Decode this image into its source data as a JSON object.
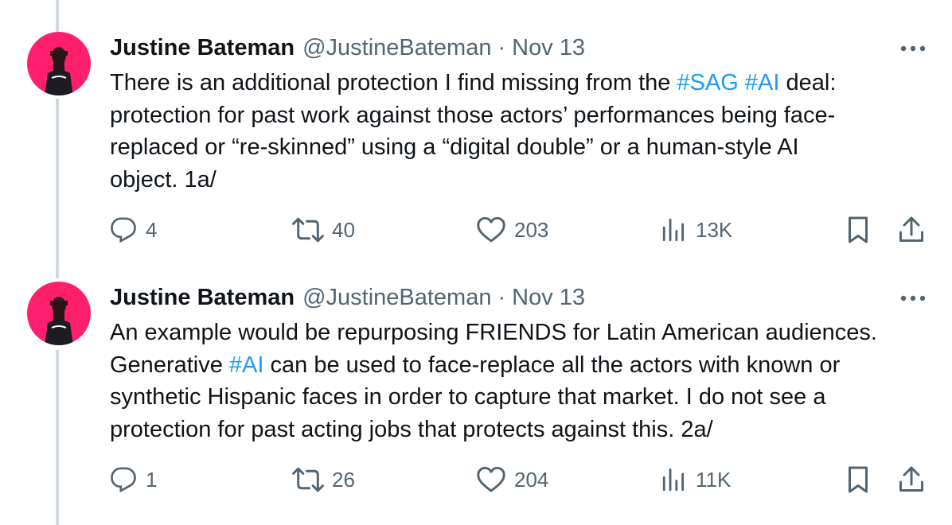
{
  "tweets": [
    {
      "author_name": "Justine Bateman",
      "handle": "@JustineBateman",
      "separator": "·",
      "date": "Nov 13",
      "text_lines": [
        [
          {
            "t": "There is an additional protection I find missing from the "
          },
          {
            "t": "#SAG",
            "h": true
          },
          {
            "t": " "
          },
          {
            "t": "#AI",
            "h": true
          },
          {
            "t": " deal:"
          }
        ],
        [
          {
            "t": "protection for past work against those actors’ performances being face-"
          }
        ],
        [
          {
            "t": "replaced or “re-skinned” using a “digital double” or a human-style AI"
          }
        ],
        [
          {
            "t": "object. 1a/"
          }
        ]
      ],
      "replies": "4",
      "retweets": "40",
      "likes": "203",
      "views": "13K"
    },
    {
      "author_name": "Justine Bateman",
      "handle": "@JustineBateman",
      "separator": "·",
      "date": "Nov 13",
      "text_lines": [
        [
          {
            "t": "An example would be repurposing FRIENDS for Latin American audiences."
          }
        ],
        [
          {
            "t": "Generative "
          },
          {
            "t": "#AI",
            "h": true
          },
          {
            "t": " can be used to face-replace all the actors with known or"
          }
        ],
        [
          {
            "t": "synthetic Hispanic faces in order to capture that market. I do not see a"
          }
        ],
        [
          {
            "t": "protection for past acting jobs that protects against this. 2a/"
          }
        ]
      ],
      "replies": "1",
      "retweets": "26",
      "likes": "204",
      "views": "11K"
    }
  ],
  "icons": {
    "reply": "reply-icon",
    "retweet": "retweet-icon",
    "like": "heart-icon",
    "views": "views-icon",
    "bookmark": "bookmark-icon",
    "share": "share-icon",
    "more": "more-icon"
  },
  "colors": {
    "hashtag": "#1d9bf0",
    "secondary_text": "#536471",
    "thread_line": "#cfd9de",
    "avatar_bg": "#ff1f6d"
  }
}
